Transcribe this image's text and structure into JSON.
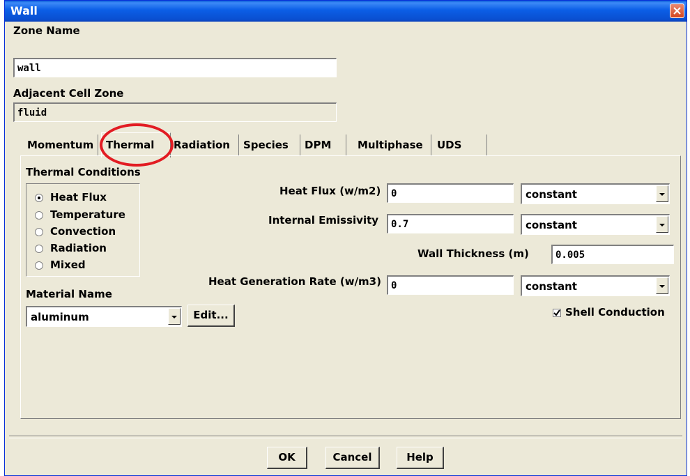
{
  "window": {
    "title": "Wall"
  },
  "zone": {
    "label": "Zone Name",
    "value": "wall",
    "adjacent_label": "Adjacent Cell Zone",
    "adjacent_value": "fluid"
  },
  "tabs": [
    "Momentum",
    "Thermal",
    "Radiation",
    "Species",
    "DPM",
    "Multiphase",
    "UDS"
  ],
  "active_tab": "Thermal",
  "thermal": {
    "group_label": "Thermal Conditions",
    "conditions": [
      "Heat Flux",
      "Temperature",
      "Convection",
      "Radiation",
      "Mixed"
    ],
    "selected": "Heat Flux",
    "material_label": "Material Name",
    "material_value": "aluminum",
    "edit_label": "Edit...",
    "heat_flux_label": "Heat Flux (w/m2)",
    "heat_flux_value": "0",
    "heat_flux_method": "constant",
    "emissivity_label": "Internal Emissivity",
    "emissivity_value": "0.7",
    "emissivity_method": "constant",
    "wall_thickness_label": "Wall Thickness (m)",
    "wall_thickness_value": "0.005",
    "heat_gen_label": "Heat Generation Rate (w/m3)",
    "heat_gen_value": "0",
    "heat_gen_method": "constant",
    "shell_conduction_label": "Shell Conduction",
    "shell_conduction_checked": true
  },
  "buttons": {
    "ok": "OK",
    "cancel": "Cancel",
    "help": "Help"
  },
  "colors": {
    "titlebar": "#0a4fd0",
    "dialog_bg": "#ece9d8",
    "highlight": "#e21c23"
  }
}
